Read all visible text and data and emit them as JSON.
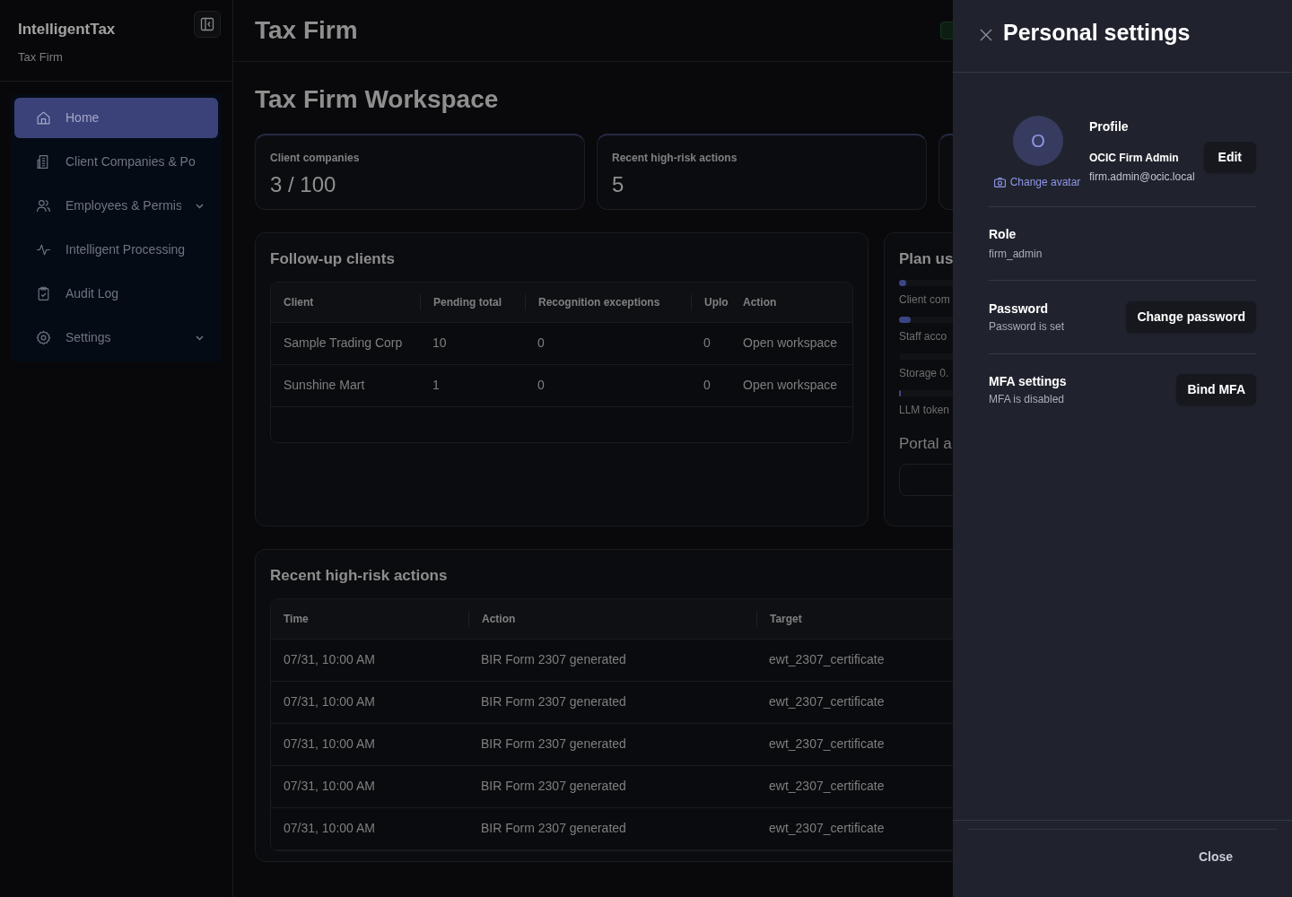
{
  "sidebar": {
    "app_name": "IntelligentTax",
    "subtitle": "Tax Firm",
    "items": [
      {
        "label": "Home",
        "kind": "home",
        "selected": true,
        "has_submenu": false
      },
      {
        "label": "Client Companies & Po",
        "kind": "building",
        "selected": false,
        "has_submenu": false
      },
      {
        "label": "Employees & Permis",
        "kind": "users",
        "selected": false,
        "has_submenu": true
      },
      {
        "label": "Intelligent Processing",
        "kind": "pulse",
        "selected": false,
        "has_submenu": false
      },
      {
        "label": "Audit Log",
        "kind": "clipboard",
        "selected": false,
        "has_submenu": false
      },
      {
        "label": "Settings",
        "kind": "gear",
        "selected": false,
        "has_submenu": true
      }
    ]
  },
  "header": {
    "title": "Tax Firm"
  },
  "page_title": "Tax Firm Workspace",
  "stats": [
    {
      "label": "Client companies",
      "value": "3 / 100"
    },
    {
      "label": "Recent high-risk actions",
      "value": "5"
    }
  ],
  "follow_up": {
    "title": "Follow-up clients",
    "columns": [
      "Client",
      "Pending total",
      "Recognition exceptions",
      "Uplo",
      "Action"
    ],
    "rows": [
      [
        "Sample Trading Corp",
        "10",
        "0",
        "0",
        "Open workspace"
      ],
      [
        "Sunshine Mart",
        "1",
        "0",
        "0",
        "Open workspace"
      ]
    ]
  },
  "plan_usage": {
    "title": "Plan us",
    "meters": [
      {
        "label": "Client com",
        "level": 0.03
      },
      {
        "label": "Staff acco",
        "level": 0.05
      },
      {
        "label": "Storage 0.",
        "level": 0
      },
      {
        "label": "LLM token",
        "level": 0.005
      }
    ],
    "portal_title": "Portal a"
  },
  "recent_actions": {
    "title": "Recent high-risk actions",
    "columns": [
      "Time",
      "Action",
      "Target"
    ],
    "rows": [
      [
        "07/31, 10:00 AM",
        "BIR Form 2307 generated",
        "ewt_2307_certificate"
      ],
      [
        "07/31, 10:00 AM",
        "BIR Form 2307 generated",
        "ewt_2307_certificate"
      ],
      [
        "07/31, 10:00 AM",
        "BIR Form 2307 generated",
        "ewt_2307_certificate"
      ],
      [
        "07/31, 10:00 AM",
        "BIR Form 2307 generated",
        "ewt_2307_certificate"
      ],
      [
        "07/31, 10:00 AM",
        "BIR Form 2307 generated",
        "ewt_2307_certificate"
      ]
    ]
  },
  "drawer": {
    "title": "Personal settings",
    "avatar_initial": "O",
    "change_avatar": "Change avatar",
    "profile_label": "Profile",
    "name": "OCIC Firm Admin",
    "email": "firm.admin@ocic.local",
    "edit_button": "Edit",
    "role_label": "Role",
    "role": "firm_admin",
    "password_label": "Password",
    "password_status": "Password is set",
    "password_button": "Change password",
    "mfa_label": "MFA settings",
    "mfa_status": "MFA is disabled",
    "mfa_button": "Bind MFA",
    "close_button": "Close"
  }
}
